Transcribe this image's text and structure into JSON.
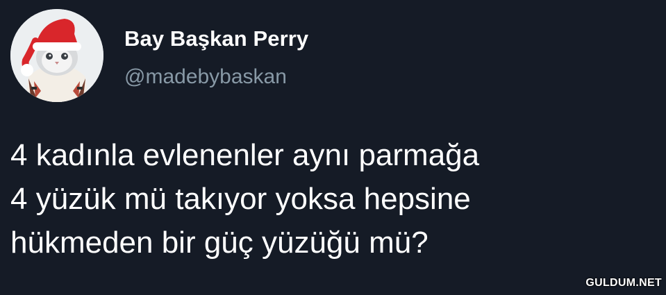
{
  "tweet": {
    "author": {
      "display_name": "Bay Başkan Perry",
      "handle": "@madebybaskan",
      "avatar_icon": "cat-santa-hat-avatar"
    },
    "text_lines": [
      "4 kadınla evlenenler aynı parmağa",
      "4 yüzük mü takıyor yoksa hepsine",
      "hükmeden bir güç yüzüğü mü?"
    ]
  },
  "watermark": "GULDUM.NET",
  "colors": {
    "background": "#151b26",
    "text": "#ffffff",
    "handle": "#8899a6"
  }
}
